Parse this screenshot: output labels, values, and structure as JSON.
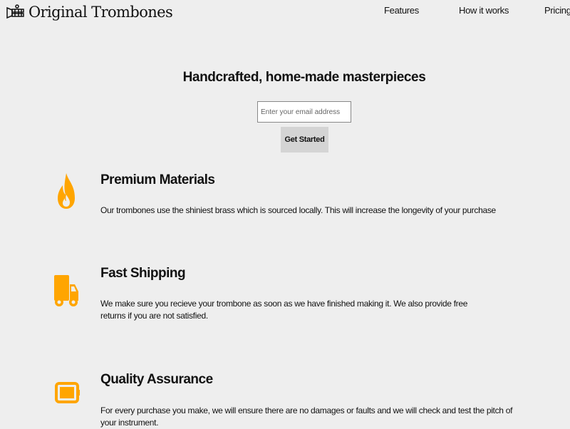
{
  "brand": {
    "name": "Original Trombones",
    "logo_icon": "trombone-icon"
  },
  "nav": {
    "items": [
      {
        "label": "Features"
      },
      {
        "label": "How it works"
      },
      {
        "label": "Pricing"
      }
    ]
  },
  "hero": {
    "title": "Handcrafted, home-made masterpieces",
    "email_placeholder": "Enter your email address",
    "email_value": "",
    "cta_label": "Get Started"
  },
  "features": [
    {
      "icon": "fire-icon",
      "title": "Premium Materials",
      "description": "Our trombones use the shiniest brass which is sourced locally. This will increase the longevity of your purchase"
    },
    {
      "icon": "truck-icon",
      "title": "Fast Shipping",
      "description": "We make sure you recieve your trombone as soon as we have finished making it. We also provide free returns if you are not satisfied."
    },
    {
      "icon": "battery-icon",
      "title": "Quality Assurance",
      "description": "For every purchase you make, we will ensure there are no damages or faults and we will check and test the pitch of your instrument."
    }
  ],
  "colors": {
    "accent": "#ffa500",
    "background": "#eeeeee",
    "button": "#d4d4d4"
  }
}
